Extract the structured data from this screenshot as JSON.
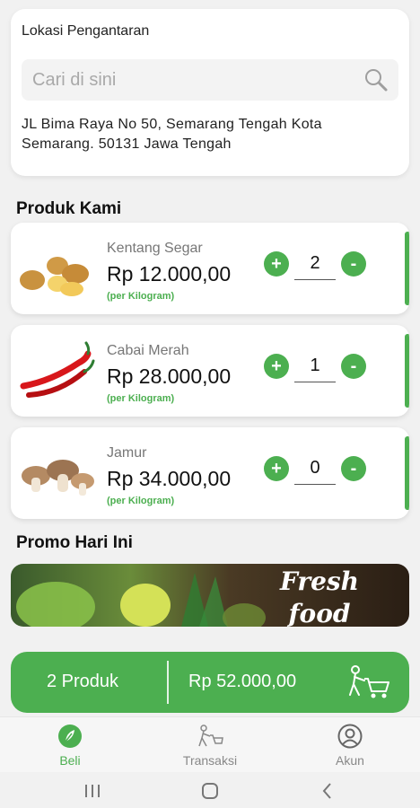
{
  "location": {
    "title": "Lokasi Pengantaran",
    "search_placeholder": "Cari di sini",
    "address": "JL Bima Raya No 50, Semarang Tengah Kota Semarang. 50131 Jawa Tengah"
  },
  "products_section_title": "Produk Kami",
  "products": [
    {
      "name": "Kentang Segar",
      "price": "Rp 12.000,00",
      "unit": "(per Kilogram)",
      "qty": "2",
      "image": "potato-image"
    },
    {
      "name": "Cabai Merah",
      "price": "Rp 28.000,00",
      "unit": "(per Kilogram)",
      "qty": "1",
      "image": "chili-image"
    },
    {
      "name": "Jamur",
      "price": "Rp 34.000,00",
      "unit": "(per Kilogram)",
      "qty": "0",
      "image": "mushroom-image"
    }
  ],
  "promo": {
    "title": "Promo Hari Ini",
    "banner_text": "Fresh food delivery"
  },
  "cart": {
    "count": "2 Produk",
    "total": "Rp 52.000,00"
  },
  "nav": [
    {
      "label": "Beli",
      "icon": "leaf-icon",
      "active": true
    },
    {
      "label": "Transaksi",
      "icon": "delivery-icon",
      "active": false
    },
    {
      "label": "Akun",
      "icon": "account-icon",
      "active": false
    }
  ],
  "colors": {
    "accent": "#4caf50",
    "background": "#f1f1f1"
  }
}
